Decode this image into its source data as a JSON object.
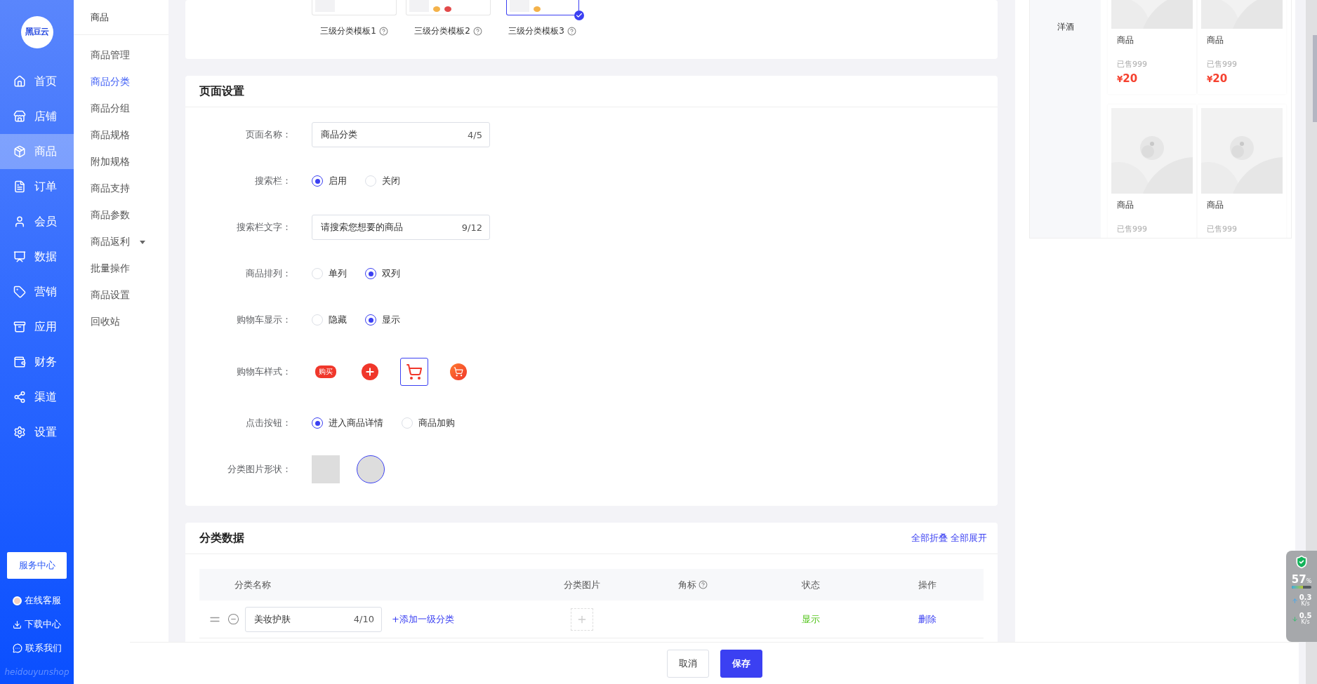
{
  "sidebar": {
    "logo": "黑豆云",
    "items": [
      {
        "label": "首页",
        "selected": false
      },
      {
        "label": "店铺",
        "selected": false
      },
      {
        "label": "商品",
        "selected": true
      },
      {
        "label": "订单",
        "selected": false
      },
      {
        "label": "会员",
        "selected": false
      },
      {
        "label": "数据",
        "selected": false
      },
      {
        "label": "营销",
        "selected": false
      },
      {
        "label": "应用",
        "selected": false
      },
      {
        "label": "财务",
        "selected": false
      },
      {
        "label": "渠道",
        "selected": false
      },
      {
        "label": "设置",
        "selected": false
      }
    ],
    "service_button": "服务中心",
    "links": [
      "在线客服",
      "下载中心",
      "联系我们"
    ],
    "brand": "heidouyunshop"
  },
  "submenu": {
    "title": "商品",
    "items": [
      {
        "label": "商品管理",
        "selected": false
      },
      {
        "label": "商品分类",
        "selected": true
      },
      {
        "label": "商品分组",
        "selected": false
      },
      {
        "label": "商品规格",
        "selected": false
      },
      {
        "label": "附加规格",
        "selected": false
      },
      {
        "label": "商品支持",
        "selected": false
      },
      {
        "label": "商品参数",
        "selected": false
      },
      {
        "label": "商品返利",
        "selected": false,
        "expandable": true
      },
      {
        "label": "批量操作",
        "selected": false
      },
      {
        "label": "商品设置",
        "selected": false
      },
      {
        "label": "回收站",
        "selected": false
      }
    ]
  },
  "templates": [
    {
      "label": "三级分类模板1",
      "selected": false
    },
    {
      "label": "三级分类模板2",
      "selected": false
    },
    {
      "label": "三级分类模板3",
      "selected": true
    }
  ],
  "page_settings": {
    "title": "页面设置",
    "rows": [
      {
        "kind": "input",
        "label": "页面名称：",
        "value": "商品分类",
        "count": "4/5"
      },
      {
        "kind": "radio",
        "label": "搜索栏：",
        "options": [
          {
            "label": "启用",
            "selected": true
          },
          {
            "label": "关闭",
            "selected": false
          }
        ]
      },
      {
        "kind": "input",
        "label": "搜索栏文字：",
        "value": "请搜索您想要的商品",
        "count": "9/12"
      },
      {
        "kind": "radio",
        "label": "商品排列：",
        "options": [
          {
            "label": "单列",
            "selected": false
          },
          {
            "label": "双列",
            "selected": true
          }
        ]
      },
      {
        "kind": "radio",
        "label": "购物车显示：",
        "options": [
          {
            "label": "隐藏",
            "selected": false
          },
          {
            "label": "显示",
            "selected": true
          }
        ]
      },
      {
        "kind": "cart_styles",
        "label": "购物车样式：",
        "options": [
          {
            "kind": "tag",
            "text": "购买",
            "selected": false
          },
          {
            "kind": "plus",
            "selected": false
          },
          {
            "kind": "outline",
            "selected": true
          },
          {
            "kind": "filled",
            "selected": false
          }
        ]
      },
      {
        "kind": "radio",
        "label": "点击按钮：",
        "options": [
          {
            "label": "进入商品详情",
            "selected": true
          },
          {
            "label": "商品加购",
            "selected": false
          }
        ]
      },
      {
        "kind": "shapes",
        "label": "分类图片形状：",
        "options": [
          {
            "kind": "square",
            "selected": false
          },
          {
            "kind": "circle",
            "selected": true
          }
        ]
      }
    ]
  },
  "category_data": {
    "title": "分类数据",
    "actions": [
      "全部折叠",
      "全部展开"
    ],
    "columns": [
      "分类名称",
      "分类图片",
      "角标",
      "状态",
      "操作"
    ],
    "rows": [
      {
        "name": "美妆护肤",
        "count": "4/10",
        "add_link": "+添加一级分类",
        "status": "显示",
        "action": "删除"
      }
    ]
  },
  "footer": {
    "buttons": [
      {
        "label": "取消",
        "kind": "default"
      },
      {
        "label": "保存",
        "kind": "primary"
      }
    ]
  },
  "preview": {
    "category": "洋酒",
    "products": [
      {
        "title": "商品",
        "sold": "已售999",
        "currency": "¥",
        "price": "20"
      },
      {
        "title": "商品",
        "sold": "已售999",
        "currency": "¥",
        "price": "20"
      },
      {
        "title": "商品",
        "sold": "已售999"
      },
      {
        "title": "商品",
        "sold": "已售999"
      }
    ]
  },
  "security_widget": {
    "percent": "57",
    "unit": "%",
    "level": 0.57,
    "upload": {
      "value": "0.3",
      "unit": "K/s"
    },
    "download": {
      "value": "0.5",
      "unit": "K/s"
    }
  }
}
